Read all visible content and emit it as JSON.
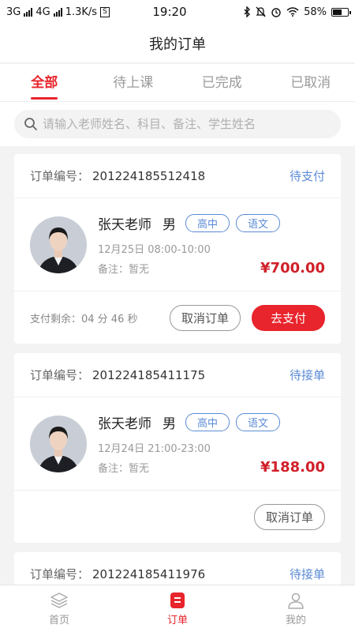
{
  "statusbar": {
    "net1": "3G",
    "net2": "4G",
    "speed": "1.3K/s",
    "sim": "S",
    "time": "19:20",
    "battery": "58%"
  },
  "navbar": {
    "title": "我的订单"
  },
  "tabs": [
    {
      "label": "全部",
      "active": true
    },
    {
      "label": "待上课"
    },
    {
      "label": "已完成"
    },
    {
      "label": "已取消"
    }
  ],
  "search": {
    "placeholder": "请输入老师姓名、科目、备注、学生姓名",
    "value": ""
  },
  "orders": [
    {
      "label": "订单编号：",
      "number": "201224185512418",
      "status": "待支付",
      "teacher": "张天老师",
      "gender": "男",
      "tags": [
        "高中",
        "语文"
      ],
      "time": "12月25日 08:00-10:00",
      "remark": "备注：暂无",
      "price": "¥700.00",
      "countdown": "支付剩余：04 分 46 秒",
      "cancel": "取消订单",
      "pay": "去支付"
    },
    {
      "label": "订单编号：",
      "number": "201224185411175",
      "status": "待接单",
      "teacher": "张天老师",
      "gender": "男",
      "tags": [
        "高中",
        "语文"
      ],
      "time": "12月24日 21:00-23:00",
      "remark": "备注：暂无",
      "price": "¥188.00",
      "cancel": "取消订单"
    },
    {
      "label": "订单编号：",
      "number": "201224185411976",
      "status": "待接单"
    }
  ],
  "bottombar": [
    {
      "label": "首页",
      "icon": "layers-icon"
    },
    {
      "label": "订单",
      "icon": "order-icon",
      "active": true
    },
    {
      "label": "我的",
      "icon": "person-icon"
    }
  ],
  "colors": {
    "accent": "#e8242c",
    "status_blue": "#5b8bd6"
  }
}
